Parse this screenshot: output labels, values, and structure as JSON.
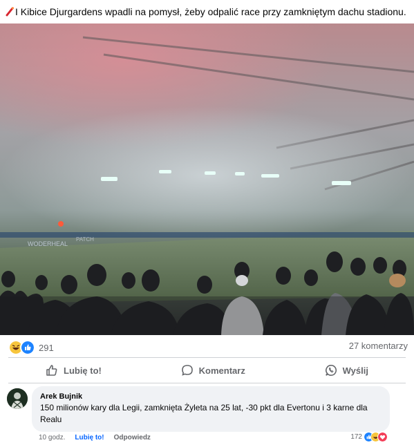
{
  "post": {
    "caption": "I Kibice Djurgardens wpadli na pomysł, żeby odpalić race przy zamkniętym dachu stadionu.",
    "reaction_count": "291",
    "comments_count": "27 komentarzy"
  },
  "actions": {
    "like": "Lubię to!",
    "comment": "Komentarz",
    "send": "Wyślij"
  },
  "comment": {
    "author": "Arek Bujnik",
    "text": "150 milionów kary dla Legii, zamknięta Żyleta na 25 lat, -30 pkt dla Evertonu i 3 karne dla Realu",
    "time": "10 godz.",
    "like": "Lubię to!",
    "reply": "Odpowiedz",
    "reaction_count": "172"
  },
  "photo": {
    "ad_text_left": "WODERHEAL",
    "ad_text_mid": "PATCH"
  },
  "icons": {
    "caption": "flare-icon",
    "reactions": [
      "haha-emoji",
      "like-emoji"
    ],
    "comment_reactions": [
      "like-emoji",
      "haha-emoji",
      "love-emoji"
    ],
    "action_icons": [
      "thumbs-up-icon",
      "comment-bubble-icon",
      "whatsapp-icon"
    ]
  },
  "colors": {
    "accent": "#0866ff",
    "secondary_text": "#65676b",
    "bubble": "#f0f2f5"
  }
}
